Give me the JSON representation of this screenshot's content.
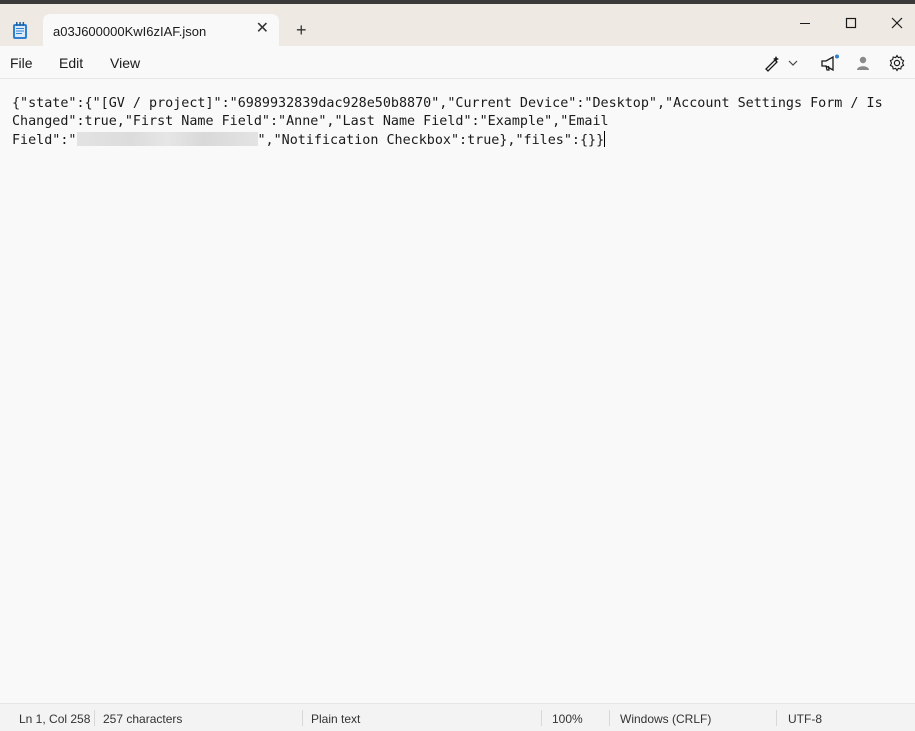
{
  "window": {
    "tab_title": "a03J600000KwI6zIAF.json",
    "new_tab_label": "+",
    "close_tab_glyph": "✕"
  },
  "menu": {
    "file": "File",
    "edit": "Edit",
    "view": "View"
  },
  "toolbar_icons": [
    "copilot-pen-icon",
    "chevron-down-icon",
    "whats-new-icon",
    "account-icon",
    "settings-icon"
  ],
  "editor": {
    "line1": "{\"state\":{\"[GV / project]\":\"6989932839dac928e50b8870\",\"Current Device\":\"Desktop\",\"Account Settings Form / Is",
    "line2": "Changed\":true,\"First Name Field\":\"Anne\",\"Last Name Field\":\"Example\",\"Email",
    "line3_before": "Field\":\"",
    "line3_after": "\",\"Notification Checkbox\":true},\"files\":{}}"
  },
  "status": {
    "position": "Ln 1, Col 258",
    "characters": "257 characters",
    "format": "Plain text",
    "zoom": "100%",
    "line_endings": "Windows (CRLF)",
    "encoding": "UTF-8"
  }
}
